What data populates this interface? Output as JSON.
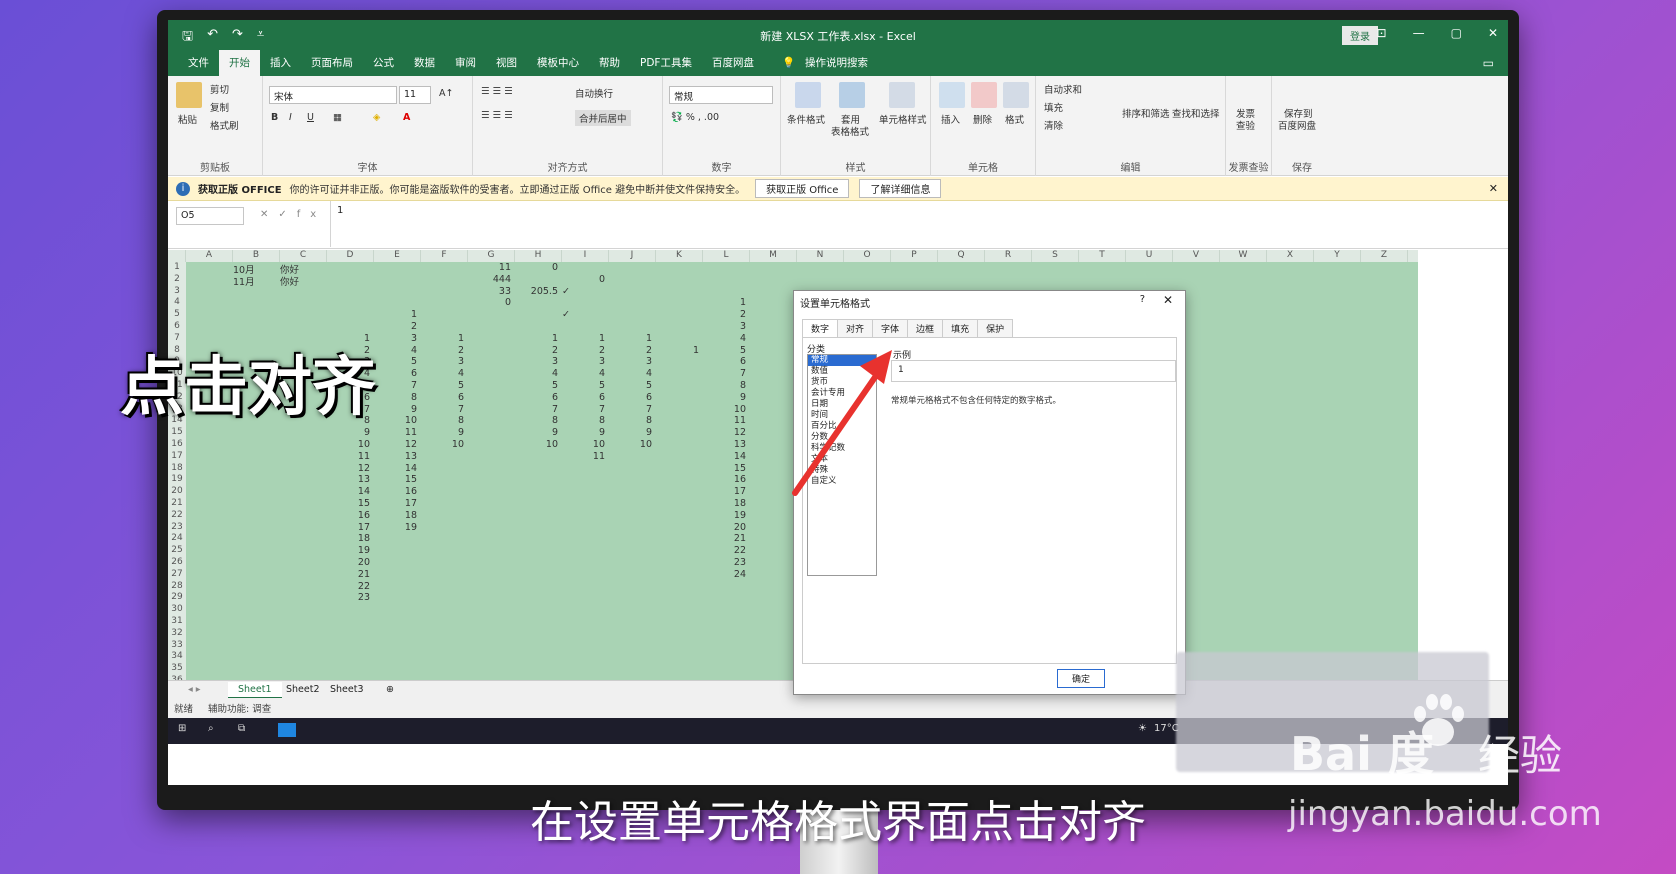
{
  "window": {
    "title": "新建 XLSX 工作表.xlsx - Excel",
    "login": "登录",
    "controls": [
      "—",
      "▢",
      "✕"
    ]
  },
  "ribbon_tabs": [
    "文件",
    "开始",
    "插入",
    "页面布局",
    "公式",
    "数据",
    "审阅",
    "视图",
    "模板中心",
    "帮助",
    "PDF工具集",
    "百度网盘"
  ],
  "tell_me": "操作说明搜索",
  "ribbon": {
    "clipboard": {
      "paste": "粘贴",
      "cut": "剪切",
      "copy": "复制",
      "painter": "格式刷",
      "label": "剪贴板"
    },
    "font": {
      "name": "宋体",
      "size": "11",
      "label": "字体",
      "bold": "B",
      "italic": "I",
      "underline": "U"
    },
    "alignment": {
      "wrap": "自动换行",
      "merge": "合并后居中",
      "label": "对齐方式"
    },
    "number": {
      "format": "常规",
      "label": "数字"
    },
    "styles": {
      "cond": "条件格式",
      "table1": "套用",
      "table2": "表格格式",
      "cell": "单元格样式",
      "label": "样式"
    },
    "cells": {
      "insert": "插入",
      "delete": "删除",
      "format": "格式",
      "label": "单元格"
    },
    "editing": {
      "autosum": "自动求和",
      "fill": "填充",
      "clear": "清除",
      "sort": "排序和筛选",
      "find": "查找和选择",
      "label": "编辑"
    },
    "invoice": {
      "btn1": "发票",
      "btn2": "查验",
      "label": "发票查验"
    },
    "save": {
      "btn1": "保存到",
      "btn2": "百度网盘",
      "label": "保存"
    }
  },
  "infobar": {
    "bold": "获取正版 OFFICE",
    "text": "你的许可证并非正版。你可能是盗版软件的受害者。立即通过正版 Office 避免中断并使文件保持安全。",
    "btn1": "获取正版 Office",
    "btn2": "了解详细信息"
  },
  "formula_bar": {
    "name_box": "O5",
    "value": "1"
  },
  "columns": [
    "A",
    "B",
    "C",
    "D",
    "E",
    "F",
    "G",
    "H",
    "I",
    "J",
    "K",
    "L",
    "M",
    "N",
    "O",
    "P",
    "Q",
    "R",
    "S",
    "T",
    "U",
    "V",
    "W",
    "X",
    "Y",
    "Z"
  ],
  "rows": [
    "1",
    "2",
    "3",
    "4",
    "5",
    "6",
    "7",
    "8",
    "9",
    "10",
    "11",
    "12",
    "13",
    "14",
    "15",
    "16",
    "17",
    "18",
    "19",
    "20",
    "21",
    "22",
    "23",
    "24",
    "25",
    "26",
    "27",
    "28",
    "29",
    "30",
    "31",
    "32",
    "33",
    "34",
    "35",
    "36"
  ],
  "cells": [
    {
      "t": "10月",
      "c": 1,
      "r": 0
    },
    {
      "t": "你好",
      "c": 2,
      "r": 0
    },
    {
      "t": "11",
      "c": 6,
      "r": 0
    },
    {
      "t": "0",
      "c": 7,
      "r": 0
    },
    {
      "t": "11月",
      "c": 1,
      "r": 1
    },
    {
      "t": "你好",
      "c": 2,
      "r": 1
    },
    {
      "t": "444",
      "c": 6,
      "r": 1
    },
    {
      "t": "0",
      "c": 8,
      "r": 1
    },
    {
      "t": "33",
      "c": 6,
      "r": 2
    },
    {
      "t": "205.5",
      "c": 7,
      "r": 2
    },
    {
      "t": "✓",
      "c": 8,
      "r": 2
    },
    {
      "t": "0",
      "c": 6,
      "r": 3
    },
    {
      "t": "1",
      "c": 11,
      "r": 3
    },
    {
      "t": "1",
      "c": 4,
      "r": 4
    },
    {
      "t": "✓",
      "c": 8,
      "r": 4
    },
    {
      "t": "2",
      "c": 11,
      "r": 4
    },
    {
      "t": "2",
      "c": 4,
      "r": 5
    },
    {
      "t": "3",
      "c": 11,
      "r": 5
    },
    {
      "t": "1",
      "c": 3,
      "r": 6
    },
    {
      "t": "3",
      "c": 4,
      "r": 6
    },
    {
      "t": "1",
      "c": 5,
      "r": 6
    },
    {
      "t": "1",
      "c": 7,
      "r": 6
    },
    {
      "t": "1",
      "c": 8,
      "r": 6
    },
    {
      "t": "1",
      "c": 9,
      "r": 6
    },
    {
      "t": "4",
      "c": 11,
      "r": 6
    },
    {
      "t": "2",
      "c": 3,
      "r": 7
    },
    {
      "t": "4",
      "c": 4,
      "r": 7
    },
    {
      "t": "2",
      "c": 5,
      "r": 7
    },
    {
      "t": "2",
      "c": 7,
      "r": 7
    },
    {
      "t": "2",
      "c": 8,
      "r": 7
    },
    {
      "t": "2",
      "c": 9,
      "r": 7
    },
    {
      "t": "1",
      "c": 10,
      "r": 7
    },
    {
      "t": "5",
      "c": 11,
      "r": 7
    },
    {
      "t": "3",
      "c": 3,
      "r": 8
    },
    {
      "t": "5",
      "c": 4,
      "r": 8
    },
    {
      "t": "3",
      "c": 5,
      "r": 8
    },
    {
      "t": "3",
      "c": 7,
      "r": 8
    },
    {
      "t": "3",
      "c": 8,
      "r": 8
    },
    {
      "t": "3",
      "c": 9,
      "r": 8
    },
    {
      "t": "6",
      "c": 11,
      "r": 8
    },
    {
      "t": "4",
      "c": 3,
      "r": 9
    },
    {
      "t": "6",
      "c": 4,
      "r": 9
    },
    {
      "t": "4",
      "c": 5,
      "r": 9
    },
    {
      "t": "4",
      "c": 7,
      "r": 9
    },
    {
      "t": "4",
      "c": 8,
      "r": 9
    },
    {
      "t": "4",
      "c": 9,
      "r": 9
    },
    {
      "t": "7",
      "c": 11,
      "r": 9
    },
    {
      "t": "5",
      "c": 3,
      "r": 10
    },
    {
      "t": "7",
      "c": 4,
      "r": 10
    },
    {
      "t": "5",
      "c": 5,
      "r": 10
    },
    {
      "t": "5",
      "c": 7,
      "r": 10
    },
    {
      "t": "5",
      "c": 8,
      "r": 10
    },
    {
      "t": "5",
      "c": 9,
      "r": 10
    },
    {
      "t": "8",
      "c": 11,
      "r": 10
    },
    {
      "t": "6",
      "c": 3,
      "r": 11
    },
    {
      "t": "8",
      "c": 4,
      "r": 11
    },
    {
      "t": "6",
      "c": 5,
      "r": 11
    },
    {
      "t": "6",
      "c": 7,
      "r": 11
    },
    {
      "t": "6",
      "c": 8,
      "r": 11
    },
    {
      "t": "6",
      "c": 9,
      "r": 11
    },
    {
      "t": "9",
      "c": 11,
      "r": 11
    },
    {
      "t": "7",
      "c": 3,
      "r": 12
    },
    {
      "t": "9",
      "c": 4,
      "r": 12
    },
    {
      "t": "7",
      "c": 5,
      "r": 12
    },
    {
      "t": "7",
      "c": 7,
      "r": 12
    },
    {
      "t": "7",
      "c": 8,
      "r": 12
    },
    {
      "t": "7",
      "c": 9,
      "r": 12
    },
    {
      "t": "10",
      "c": 11,
      "r": 12
    },
    {
      "t": "8",
      "c": 3,
      "r": 13
    },
    {
      "t": "10",
      "c": 4,
      "r": 13
    },
    {
      "t": "8",
      "c": 5,
      "r": 13
    },
    {
      "t": "8",
      "c": 7,
      "r": 13
    },
    {
      "t": "8",
      "c": 8,
      "r": 13
    },
    {
      "t": "8",
      "c": 9,
      "r": 13
    },
    {
      "t": "11",
      "c": 11,
      "r": 13
    },
    {
      "t": "9",
      "c": 3,
      "r": 14
    },
    {
      "t": "11",
      "c": 4,
      "r": 14
    },
    {
      "t": "9",
      "c": 5,
      "r": 14
    },
    {
      "t": "9",
      "c": 7,
      "r": 14
    },
    {
      "t": "9",
      "c": 8,
      "r": 14
    },
    {
      "t": "9",
      "c": 9,
      "r": 14
    },
    {
      "t": "12",
      "c": 11,
      "r": 14
    },
    {
      "t": "10",
      "c": 3,
      "r": 15
    },
    {
      "t": "12",
      "c": 4,
      "r": 15
    },
    {
      "t": "10",
      "c": 5,
      "r": 15
    },
    {
      "t": "10",
      "c": 7,
      "r": 15
    },
    {
      "t": "10",
      "c": 8,
      "r": 15
    },
    {
      "t": "10",
      "c": 9,
      "r": 15
    },
    {
      "t": "13",
      "c": 11,
      "r": 15
    },
    {
      "t": "11",
      "c": 3,
      "r": 16
    },
    {
      "t": "13",
      "c": 4,
      "r": 16
    },
    {
      "t": "11",
      "c": 8,
      "r": 16
    },
    {
      "t": "14",
      "c": 11,
      "r": 16
    },
    {
      "t": "12",
      "c": 3,
      "r": 17
    },
    {
      "t": "14",
      "c": 4,
      "r": 17
    },
    {
      "t": "15",
      "c": 11,
      "r": 17
    },
    {
      "t": "13",
      "c": 3,
      "r": 18
    },
    {
      "t": "15",
      "c": 4,
      "r": 18
    },
    {
      "t": "16",
      "c": 11,
      "r": 18
    },
    {
      "t": "14",
      "c": 3,
      "r": 19
    },
    {
      "t": "16",
      "c": 4,
      "r": 19
    },
    {
      "t": "17",
      "c": 11,
      "r": 19
    },
    {
      "t": "15",
      "c": 3,
      "r": 20
    },
    {
      "t": "17",
      "c": 4,
      "r": 20
    },
    {
      "t": "18",
      "c": 11,
      "r": 20
    },
    {
      "t": "16",
      "c": 3,
      "r": 21
    },
    {
      "t": "18",
      "c": 4,
      "r": 21
    },
    {
      "t": "19",
      "c": 11,
      "r": 21
    },
    {
      "t": "17",
      "c": 3,
      "r": 22
    },
    {
      "t": "19",
      "c": 4,
      "r": 22
    },
    {
      "t": "20",
      "c": 11,
      "r": 22
    },
    {
      "t": "18",
      "c": 3,
      "r": 23
    },
    {
      "t": "21",
      "c": 11,
      "r": 23
    },
    {
      "t": "19",
      "c": 3,
      "r": 24
    },
    {
      "t": "22",
      "c": 11,
      "r": 24
    },
    {
      "t": "20",
      "c": 3,
      "r": 25
    },
    {
      "t": "23",
      "c": 11,
      "r": 25
    },
    {
      "t": "21",
      "c": 3,
      "r": 26
    },
    {
      "t": "24",
      "c": 11,
      "r": 26
    },
    {
      "t": "22",
      "c": 3,
      "r": 27
    },
    {
      "t": "23",
      "c": 3,
      "r": 28
    }
  ],
  "sheets": [
    "Sheet1",
    "Sheet2",
    "Sheet3"
  ],
  "status": {
    "ready": "就绪",
    "accessibility": "辅助功能: 调查"
  },
  "taskbar": {
    "temp": "17°C"
  },
  "dialog": {
    "title": "设置单元格格式",
    "help": "?",
    "tabs": [
      "数字",
      "对齐",
      "字体",
      "边框",
      "填充",
      "保护"
    ],
    "category_label": "分类",
    "categories": [
      "常规",
      "数值",
      "货币",
      "会计专用",
      "日期",
      "时间",
      "百分比",
      "分数",
      "科学记数",
      "文本",
      "特殊",
      "自定义"
    ],
    "sample_label": "示例",
    "sample_value": "1",
    "description": "常规单元格格式不包含任何特定的数字格式。",
    "ok": "确定"
  },
  "overlay": {
    "caption_big": "点击对齐",
    "caption_bottom": "在设置单元格格式界面点击对齐",
    "wm_logo": "Bai 度",
    "wm_jy": "经验",
    "wm_url": "jingyan.baidu.com"
  }
}
